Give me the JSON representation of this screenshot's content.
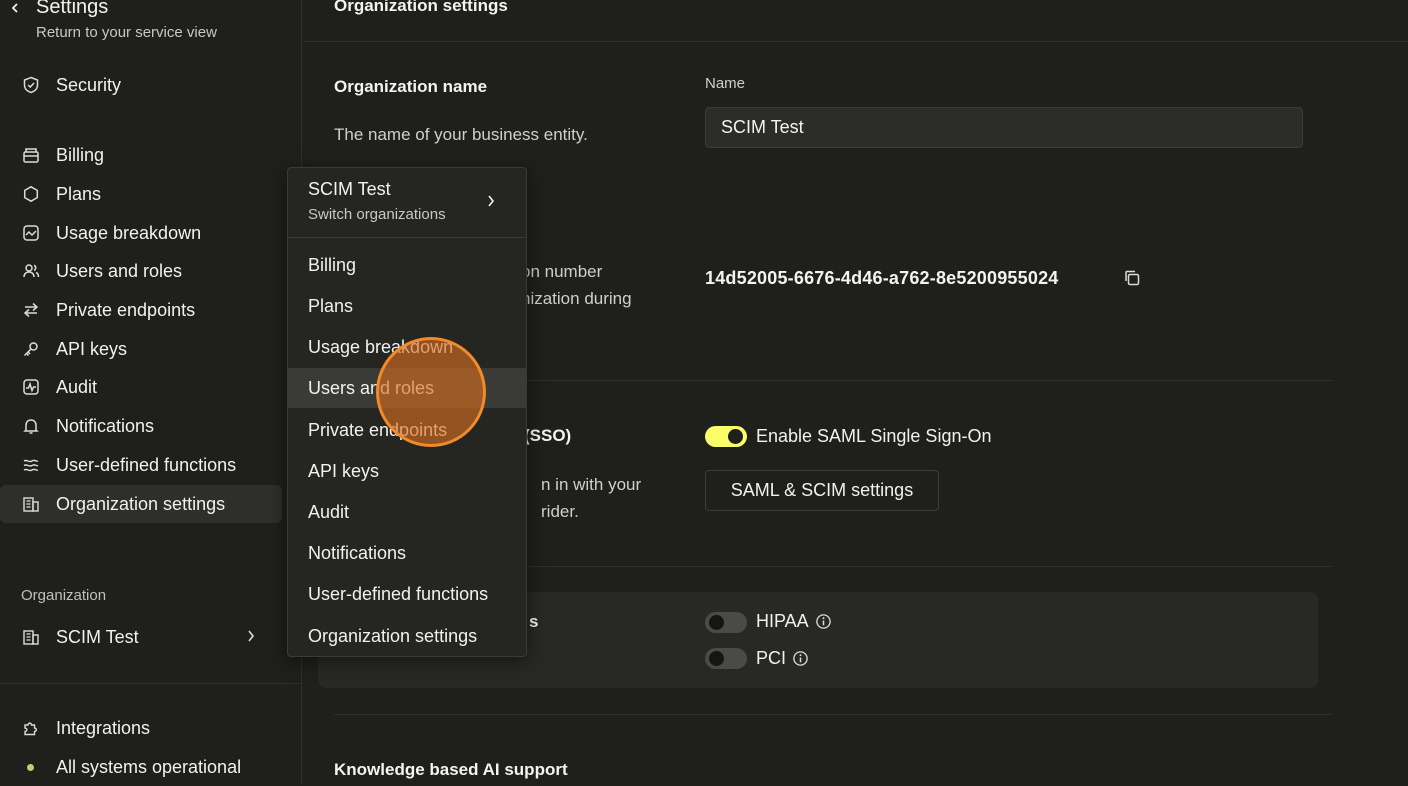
{
  "sidebar": {
    "back_title": "Settings",
    "back_sub": "Return to your service view",
    "items": [
      {
        "label": "Security",
        "icon": "shield-icon"
      },
      {
        "label": "Billing",
        "icon": "wallet-icon"
      },
      {
        "label": "Plans",
        "icon": "hexagon-icon"
      },
      {
        "label": "Usage breakdown",
        "icon": "chart-icon"
      },
      {
        "label": "Users and roles",
        "icon": "users-icon"
      },
      {
        "label": "Private endpoints",
        "icon": "arrows-icon"
      },
      {
        "label": "API keys",
        "icon": "key-icon"
      },
      {
        "label": "Audit",
        "icon": "activity-icon"
      },
      {
        "label": "Notifications",
        "icon": "bell-icon"
      },
      {
        "label": "User-defined functions",
        "icon": "wave-icon"
      },
      {
        "label": "Organization settings",
        "icon": "building-icon"
      }
    ],
    "org_section_label": "Organization",
    "org_name": "SCIM Test",
    "integrations": "Integrations",
    "status": "All systems operational"
  },
  "main": {
    "page_title": "Organization settings",
    "org_name_title": "Organization name",
    "org_name_desc": "The name of your business entity.",
    "name_label": "Name",
    "name_value": "SCIM Test",
    "org_id_desc_line1": "on number",
    "org_id_desc_line2": "nization during",
    "org_id": "14d52005-6676-4d46-a762-8e5200955024",
    "sso_title_partial": "(SSO)",
    "sso_desc_line1": "n in with your",
    "sso_desc_line2": "rider.",
    "saml_toggle_label": "Enable SAML Single Sign-On",
    "saml_button": "SAML & SCIM settings",
    "compliance_title_partial": "s",
    "hipaa_label": "HIPAA",
    "pci_label": "PCI",
    "ai_support_title": "Knowledge based AI support"
  },
  "menu": {
    "org_name": "SCIM Test",
    "switch_label": "Switch organizations",
    "items": [
      "Billing",
      "Plans",
      "Usage breakdown",
      "Users and roles",
      "Private endpoints",
      "API keys",
      "Audit",
      "Notifications",
      "User-defined functions",
      "Organization settings"
    ]
  },
  "colors": {
    "background": "#1f1f1c",
    "toggle_on": "#faff69",
    "status_dot": "#b7d27a",
    "cursor": "#f08a2c"
  }
}
